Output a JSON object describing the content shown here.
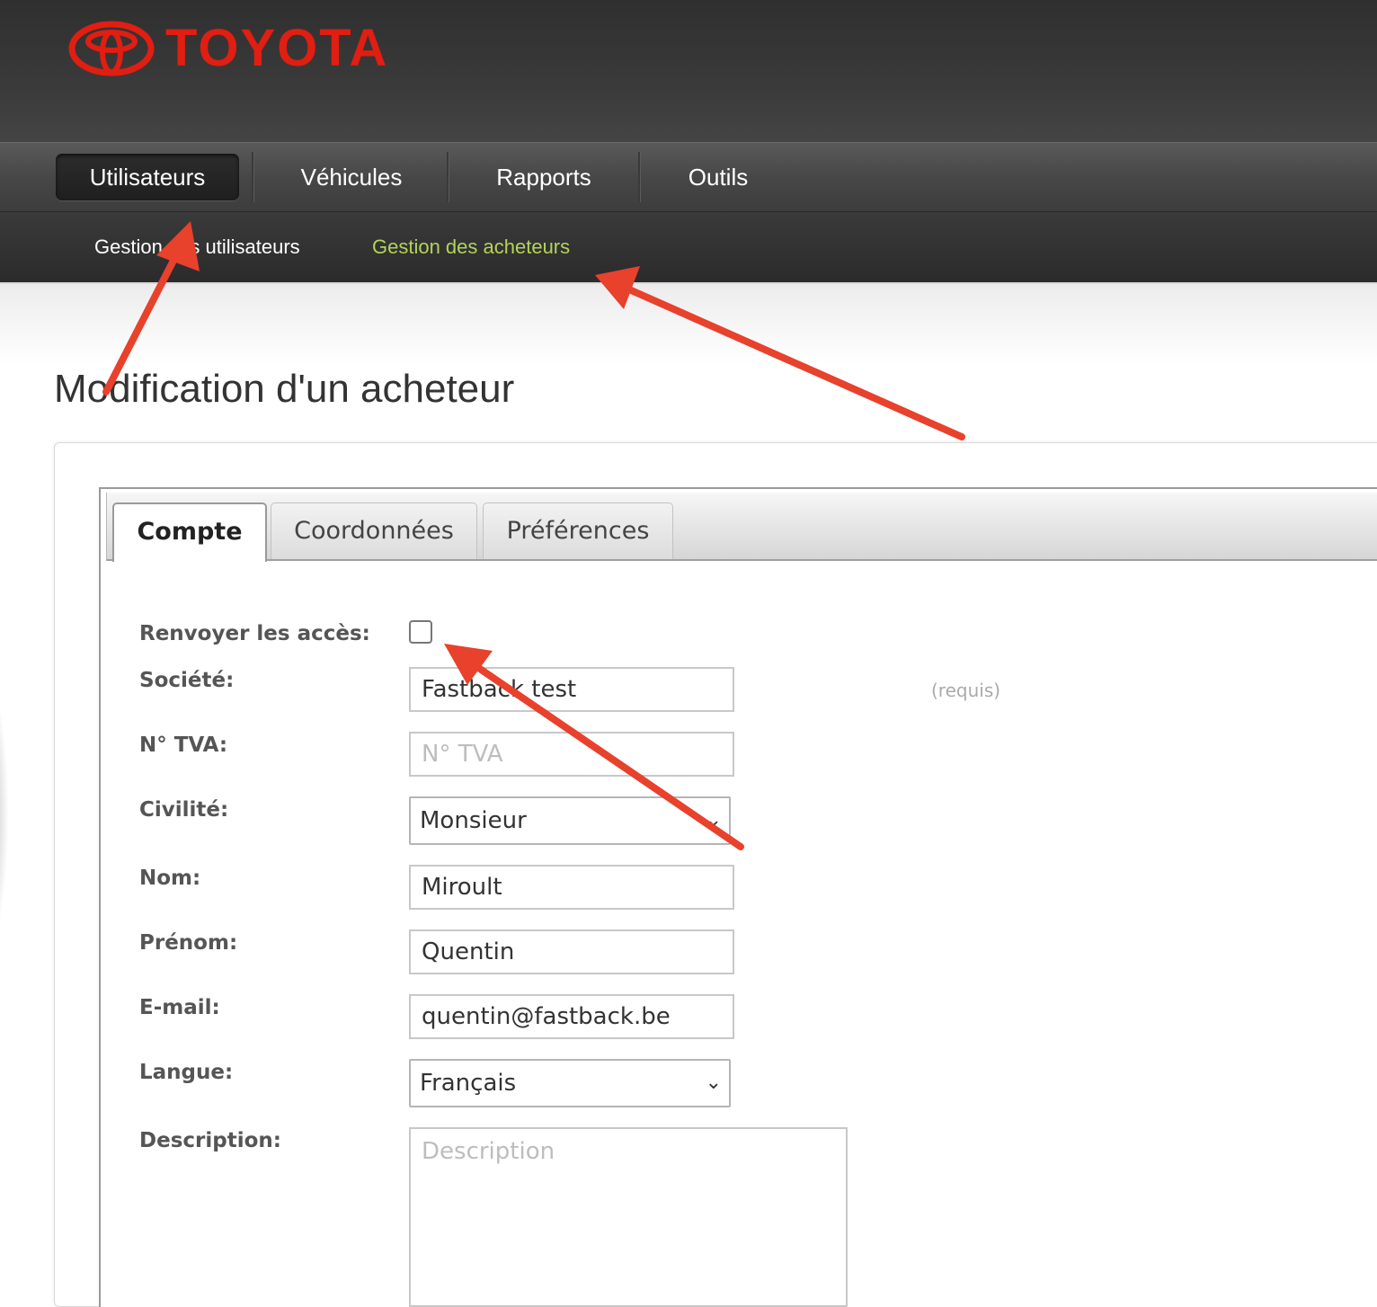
{
  "brand": {
    "name": "TOYOTA",
    "color": "#e01e12"
  },
  "nav": {
    "items": [
      {
        "label": "Utilisateurs",
        "active": true
      },
      {
        "label": "Véhicules",
        "active": false
      },
      {
        "label": "Rapports",
        "active": false
      },
      {
        "label": "Outils",
        "active": false
      }
    ]
  },
  "subnav": {
    "items": [
      {
        "label": "Gestion des utilisateurs",
        "highlighted": false
      },
      {
        "label": "Gestion des acheteurs",
        "highlighted": true
      }
    ],
    "highlight_color": "#b3d35a"
  },
  "page": {
    "title": "Modification d'un acheteur"
  },
  "tabs": [
    {
      "label": "Compte",
      "active": true
    },
    {
      "label": "Coordonnées",
      "active": false
    },
    {
      "label": "Préférences",
      "active": false
    }
  ],
  "form": {
    "resend_access": {
      "label": "Renvoyer les accès:",
      "checked": false
    },
    "company": {
      "label": "Société:",
      "value": "Fastback test",
      "required_note": "(requis)"
    },
    "vat": {
      "label": "N° TVA:",
      "value": "",
      "placeholder": "N° TVA"
    },
    "civility": {
      "label": "Civilité:",
      "selected": "Monsieur"
    },
    "last_name": {
      "label": "Nom:",
      "value": "Miroult"
    },
    "first_name": {
      "label": "Prénom:",
      "value": "Quentin"
    },
    "email": {
      "label": "E-mail:",
      "value": "quentin@fastback.be"
    },
    "language": {
      "label": "Langue:",
      "selected": "Français"
    },
    "description": {
      "label": "Description:",
      "value": "",
      "placeholder": "Description"
    }
  },
  "annotation_color": "#e8412c"
}
